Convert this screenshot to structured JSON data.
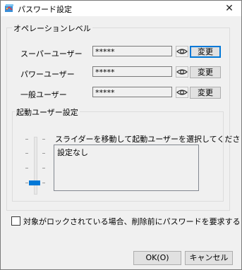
{
  "window": {
    "title": "パスワード設定",
    "close_glyph": "✕"
  },
  "operation_level": {
    "group_label": "オペレーションレベル",
    "rows": [
      {
        "label": "スーパーユーザー",
        "password": "*****",
        "change_label": "変更"
      },
      {
        "label": "パワーユーザー",
        "password": "*****",
        "change_label": "変更"
      },
      {
        "label": "一般ユーザー",
        "password": "*****",
        "change_label": "変更"
      }
    ]
  },
  "startup_user": {
    "group_label": "起動ユーザー設定",
    "hint": "スライダーを移動して起動ユーザーを選択してください。",
    "selection": "設定なし",
    "slider_position": 0
  },
  "lock_option": {
    "checked": false,
    "label": "対象がロックされている場合、削除前にパスワードを要求する"
  },
  "footer": {
    "ok_label": "OK(O)",
    "cancel_label": "キャンセル"
  },
  "icons": {
    "app": "app-icon",
    "eye": "eye-icon",
    "close": "close-icon"
  },
  "colors": {
    "accent": "#0078d7",
    "window_bg": "#f0f0f0"
  }
}
